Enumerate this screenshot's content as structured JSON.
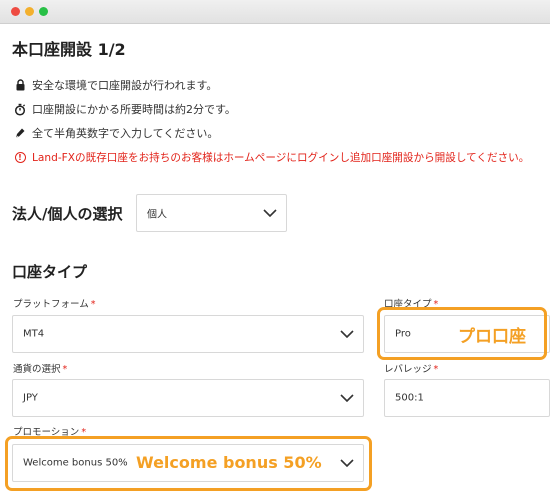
{
  "window": {
    "controls": [
      "close",
      "minimize",
      "maximize"
    ]
  },
  "page": {
    "title": "本口座開設 1/2"
  },
  "notices": [
    {
      "icon": "lock-icon",
      "text": "安全な環境で口座開設が行われます。"
    },
    {
      "icon": "stopwatch-icon",
      "text": "口座開設にかかる所要時間は約2分です。"
    },
    {
      "icon": "pen-icon",
      "text": "全て半角英数字で入力してください。"
    },
    {
      "icon": "warning-icon",
      "text": "Land-FXの既存口座をお持ちのお客様はホームページにログインし追加口座開設から開設してください。"
    }
  ],
  "entity": {
    "label": "法人/個人の選択",
    "value": "個人"
  },
  "account_type": {
    "heading": "口座タイプ",
    "platform": {
      "label": "プラットフォーム",
      "value": "MT4"
    },
    "type": {
      "label": "口座タイプ",
      "value": "Pro"
    },
    "currency": {
      "label": "通貨の選択",
      "value": "JPY"
    },
    "leverage": {
      "label": "レバレッジ",
      "value": "500:1"
    },
    "promotion": {
      "label": "プロモーション",
      "value": "Welcome bonus 50%"
    }
  },
  "required_mark": "*",
  "annotations": {
    "pro": "プロ口座",
    "promotion": "Welcome bonus 50%"
  },
  "colors": {
    "accent": "#f4a024",
    "required": "#e2231a"
  }
}
